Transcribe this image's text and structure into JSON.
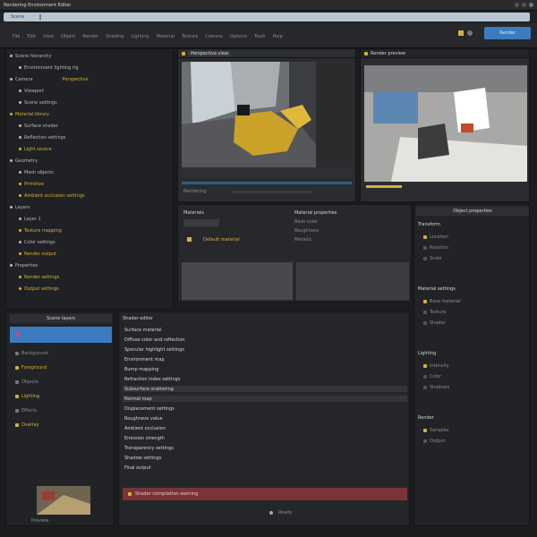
{
  "window": {
    "title": "Rendering Environment Editor",
    "tab_label": "Scene"
  },
  "toolbar": {
    "items": [
      "File",
      "Edit",
      "View",
      "Object",
      "Render",
      "Shading",
      "Lighting",
      "Material",
      "Texture",
      "Camera",
      "Options",
      "Tools",
      "Help"
    ],
    "action_button": "Render"
  },
  "outliner": {
    "items": [
      {
        "label": "Scene hierarchy",
        "depth": 0,
        "color": "#b9b9b9"
      },
      {
        "label": "Environment lighting rig",
        "depth": 1,
        "color": "#b9b9b9"
      },
      {
        "label": "Camera",
        "depth": 0,
        "color": "#b9b9b9",
        "value": "Perspective"
      },
      {
        "label": "Viewport",
        "depth": 1,
        "color": "#b9b9b9"
      },
      {
        "label": "Scene settings",
        "depth": 1,
        "color": "#b9b9b9"
      },
      {
        "label": "Material library",
        "depth": 0,
        "color": "#d4b13c"
      },
      {
        "label": "Surface shader",
        "depth": 1,
        "color": "#b9b9b9"
      },
      {
        "label": "Reflection settings",
        "depth": 1,
        "color": "#b9b9b9"
      },
      {
        "label": "Light source",
        "depth": 1,
        "color": "#d4b13c"
      },
      {
        "label": "Geometry",
        "depth": 0,
        "color": "#b9b9b9"
      },
      {
        "label": "Mesh objects",
        "depth": 1,
        "color": "#b9b9b9"
      },
      {
        "label": "Primitive",
        "depth": 1,
        "color": "#d4b13c"
      },
      {
        "label": "Ambient occlusion settings",
        "depth": 1,
        "color": "#d4b13c"
      },
      {
        "label": "Layers",
        "depth": 0,
        "color": "#b9b9b9"
      },
      {
        "label": "Layer 1",
        "depth": 1,
        "color": "#b9b9b9"
      },
      {
        "label": "Texture mapping",
        "depth": 1,
        "color": "#d4b13c"
      },
      {
        "label": "Color settings",
        "depth": 1,
        "color": "#b9b9b9"
      },
      {
        "label": "Render output",
        "depth": 1,
        "color": "#d4b13c"
      },
      {
        "label": "Properties",
        "depth": 0,
        "color": "#b9b9b9"
      },
      {
        "label": "Render settings",
        "depth": 1,
        "color": "#d4b13c"
      },
      {
        "label": "Output settings",
        "depth": 1,
        "color": "#d4b13c"
      }
    ]
  },
  "viewport_left": {
    "header": "Perspective view",
    "status": "Rendering"
  },
  "viewport_right": {
    "header": "Render preview"
  },
  "mid_panel": {
    "left_header": "Materials",
    "left_value": "Default material",
    "right_header": "Material properties",
    "right_items": [
      "Base color",
      "Roughness",
      "Metallic"
    ]
  },
  "layers_panel": {
    "header": "Scene layers",
    "items": [
      "Background",
      "Foreground",
      "Objects",
      "Lighting",
      "Effects",
      "Overlay"
    ],
    "thumbnail_caption": "Preview"
  },
  "editor": {
    "header": "Shader editor",
    "lines": [
      "Surface material",
      "Diffuse color and reflection",
      "Specular highlight settings",
      "Environment map",
      "Bump mapping",
      "Refraction index settings",
      "Subsurface scattering",
      "Normal map",
      "Displacement settings",
      "Roughness value",
      "Ambient occlusion",
      "Emission strength",
      "Transparency settings",
      "Shadow settings",
      "Final output"
    ],
    "error_banner": "Shader compilation warning",
    "footer": "Ready"
  },
  "properties": {
    "header": "Object properties",
    "sections": [
      {
        "title": "Transform",
        "items": [
          "Location",
          "Rotation",
          "Scale"
        ]
      },
      {
        "title": "Material settings",
        "items": [
          "Base material",
          "Texture",
          "Shader"
        ]
      },
      {
        "title": "Lighting",
        "items": [
          "Intensity",
          "Color",
          "Shadows"
        ]
      },
      {
        "title": "Render",
        "items": [
          "Samples",
          "Output"
        ]
      }
    ]
  },
  "colors": {
    "accent_blue": "#3b7bbf",
    "accent_yellow": "#d4b13c",
    "error_red": "#7a3336"
  }
}
